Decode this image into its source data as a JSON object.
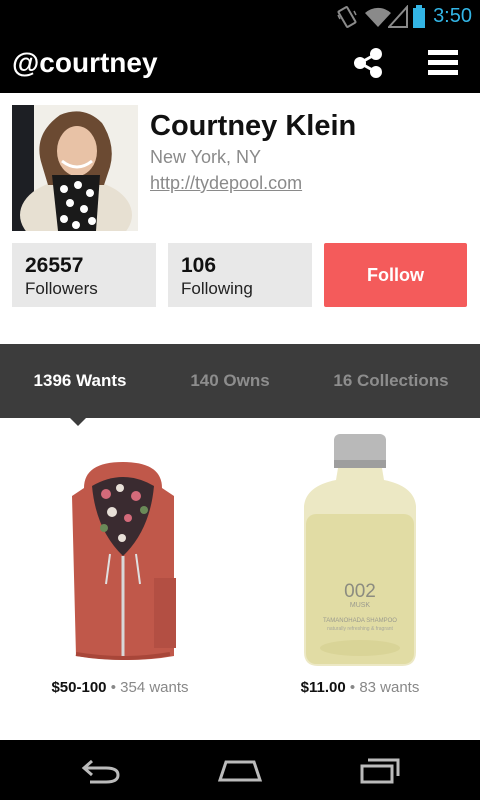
{
  "status_bar": {
    "time": "3:50",
    "icons": [
      "vibrate-icon",
      "wifi-icon",
      "signal-icon",
      "battery-icon"
    ],
    "time_color": "#33b5e5"
  },
  "app_bar": {
    "title": "@courtney",
    "actions": [
      "share-icon",
      "menu-icon"
    ]
  },
  "profile": {
    "name": "Courtney Klein",
    "location": "New York, NY",
    "link": "http://tydepool.com",
    "followers": {
      "count": "26557",
      "label": "Followers"
    },
    "following": {
      "count": "106",
      "label": "Following"
    },
    "follow_label": "Follow",
    "follow_color": "#f45b5b"
  },
  "tabs": [
    {
      "label": "1396 Wants",
      "active": true
    },
    {
      "label": "140 Owns",
      "active": false
    },
    {
      "label": "16 Collections",
      "active": false
    }
  ],
  "items": [
    {
      "image": "red-hoodie-product",
      "price": "$50-100",
      "separator": "•",
      "wants": "354 wants"
    },
    {
      "image": "shampoo-bottle-product",
      "price": "$11.00",
      "separator": "•",
      "wants": "83 wants",
      "product_label": {
        "number": "002",
        "scent": "MUSK",
        "brand": "TAMANOHADA SHAMPOO",
        "note": "naturally refreshing & fragrant"
      }
    }
  ],
  "nav_bar": {
    "buttons": [
      "back-icon",
      "home-icon",
      "recent-apps-icon"
    ]
  }
}
